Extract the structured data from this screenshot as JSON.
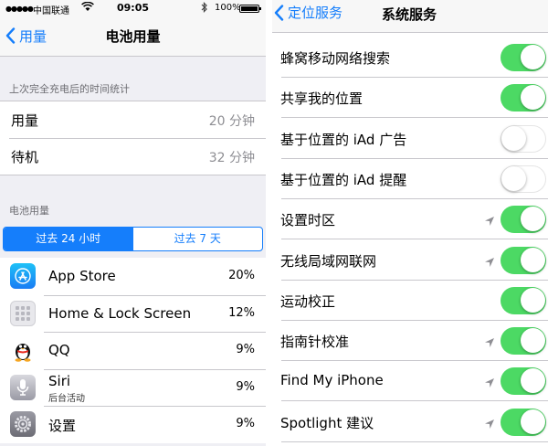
{
  "status_bar": {
    "carrier": "中国联通",
    "time": "09:05",
    "battery_percent": "100%",
    "signal_level": 5,
    "wifi_icon": "wifi-icon",
    "bluetooth_icon": "bluetooth-icon"
  },
  "left": {
    "nav": {
      "back_label": "用量",
      "title": "电池用量"
    },
    "section_stats_header": "上次完全充电后的时间统计",
    "stats": [
      {
        "label": "用量",
        "value": "20 分钟"
      },
      {
        "label": "待机",
        "value": "32 分钟"
      }
    ],
    "section_usage_header": "电池用量",
    "segments": [
      {
        "label": "过去 24 小时",
        "active": true
      },
      {
        "label": "过去 7 天",
        "active": false
      }
    ],
    "apps": [
      {
        "name": "App Store",
        "sub": "",
        "percent": "20%",
        "icon": "app-store-icon"
      },
      {
        "name": "Home & Lock Screen",
        "sub": "",
        "percent": "12%",
        "icon": "home-lock-screen-icon"
      },
      {
        "name": "QQ",
        "sub": "",
        "percent": "9%",
        "icon": "qq-icon"
      },
      {
        "name": "Siri",
        "sub": "后台活动",
        "percent": "9%",
        "icon": "siri-icon"
      },
      {
        "name": "设置",
        "sub": "",
        "percent": "9%",
        "icon": "settings-gear-icon"
      }
    ]
  },
  "right": {
    "nav": {
      "back_label": "定位服务",
      "title": "系统服务"
    },
    "items": [
      {
        "label": "蜂窝移动网络搜索",
        "on": true,
        "arrow": false
      },
      {
        "label": "共享我的位置",
        "on": true,
        "arrow": false
      },
      {
        "label": "基于位置的 iAd 广告",
        "on": false,
        "arrow": false
      },
      {
        "label": "基于位置的 iAd 提醒",
        "on": false,
        "arrow": false
      },
      {
        "label": "设置时区",
        "on": true,
        "arrow": true
      },
      {
        "label": "无线局域网联网",
        "on": true,
        "arrow": true
      },
      {
        "label": "运动校正",
        "on": true,
        "arrow": false
      },
      {
        "label": "指南针校准",
        "on": true,
        "arrow": true
      },
      {
        "label": "Find My iPhone",
        "on": true,
        "arrow": true
      },
      {
        "label": "Spotlight 建议",
        "on": true,
        "arrow": true
      }
    ]
  },
  "colors": {
    "accent": "#157efb",
    "toggle_on": "#4cd964",
    "grouped_bg": "#efeff4",
    "secondary_text": "#8e8e93"
  }
}
